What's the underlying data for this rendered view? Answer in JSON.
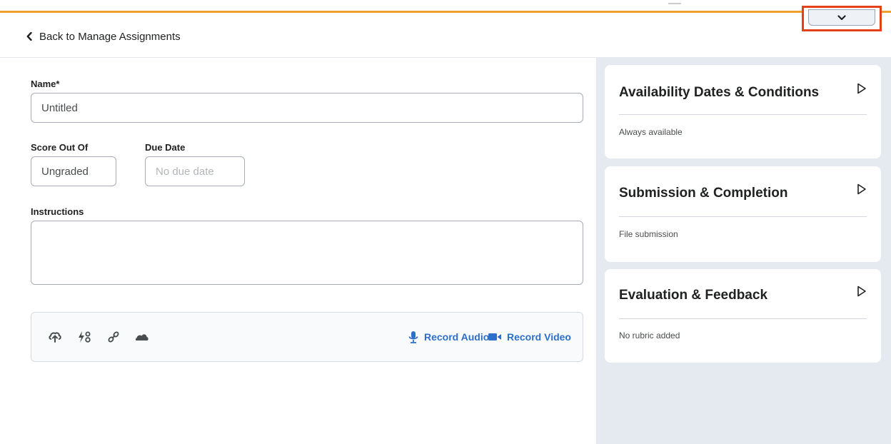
{
  "back_link": {
    "label": "Back to Manage Assignments"
  },
  "form": {
    "name_label": "Name*",
    "name_value": "Untitled",
    "score_label": "Score Out Of",
    "score_value": "Ungraded",
    "due_label": "Due Date",
    "due_placeholder": "No due date",
    "instructions_label": "Instructions"
  },
  "toolbar": {
    "icons": [
      "upload-icon",
      "equation-icon",
      "link-icon",
      "onedrive-icon"
    ],
    "record_audio": "Record Audio",
    "record_video": "Record Video"
  },
  "panel": {
    "cards": [
      {
        "title": "Availability Dates & Conditions",
        "summary": "Always available"
      },
      {
        "title": "Submission & Completion",
        "summary": "File submission"
      },
      {
        "title": "Evaluation & Feedback",
        "summary": "No rubric added"
      }
    ]
  },
  "colors": {
    "accent": "#f0a02c",
    "link": "#2e6fc9",
    "highlight": "#e2411a",
    "panel_bg": "#e5e9f0"
  }
}
